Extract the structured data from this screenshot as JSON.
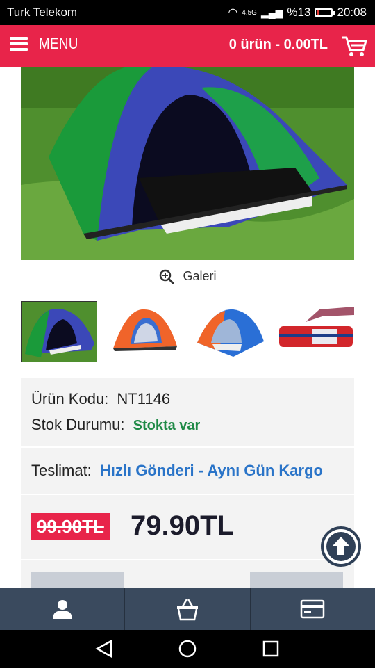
{
  "status_bar": {
    "carrier": "Turk Telekom",
    "network": "4.5G",
    "battery": "%13",
    "time": "20:08"
  },
  "header": {
    "menu_label": "MENU",
    "cart_summary": "0 ürün - 0.00TL"
  },
  "gallery": {
    "label": "Galeri"
  },
  "product": {
    "code_label": "Ürün Kodu:",
    "code_value": "NT1146",
    "stock_label": "Stok Durumu:",
    "stock_value": "Stokta var",
    "delivery_label": "Teslimat:",
    "delivery_value": "Hızlı Gönderi - Aynı Gün Kargo",
    "old_price": "99.90TL",
    "new_price": "79.90TL"
  },
  "colors": {
    "brand": "#e8244a",
    "nav": "#3a4a5e",
    "stock": "#1f8a46",
    "link": "#2a74c8"
  },
  "icons": {
    "menu": "hamburger-icon",
    "cart": "cart-icon",
    "zoom": "zoom-in-icon",
    "back_to_top": "arrow-up-icon",
    "user": "user-icon",
    "basket": "basket-icon",
    "card": "credit-card-icon"
  }
}
